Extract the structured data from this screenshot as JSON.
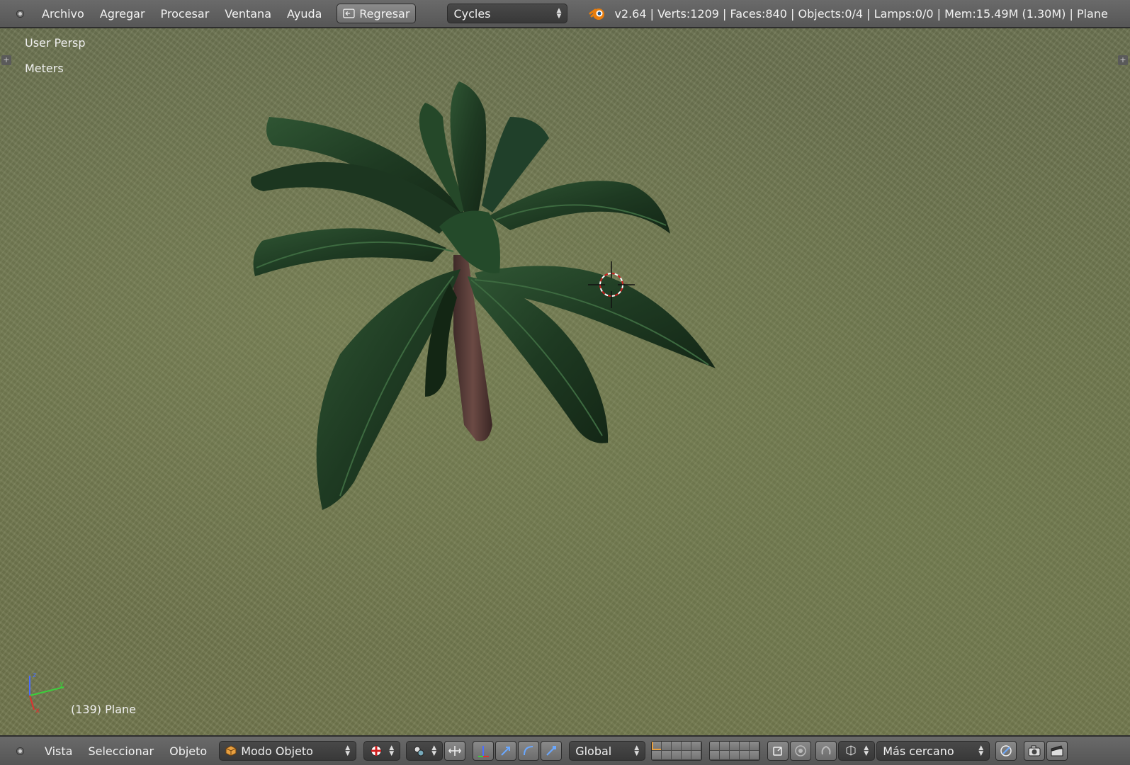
{
  "header": {
    "menus": [
      "Archivo",
      "Agregar",
      "Procesar",
      "Ventana",
      "Ayuda"
    ],
    "back_button": "Regresar",
    "render_engine": "Cycles",
    "stats": "v2.64 | Verts:1209 | Faces:840 | Objects:0/4 | Lamps:0/0 | Mem:15.49M (1.30M) | Plane"
  },
  "viewport": {
    "view_name": "User Persp",
    "units": "Meters",
    "object_label": "(139) Plane"
  },
  "footer": {
    "menus": [
      "Vista",
      "Seleccionar",
      "Objeto"
    ],
    "mode": "Modo Objeto",
    "orientation": "Global",
    "pivot_snap": "Más cercano"
  },
  "colors": {
    "header_bg": "#5f5f5f",
    "ground": "#6f7553",
    "leaf": "#1f3a22",
    "trunk": "#5a3a35"
  }
}
